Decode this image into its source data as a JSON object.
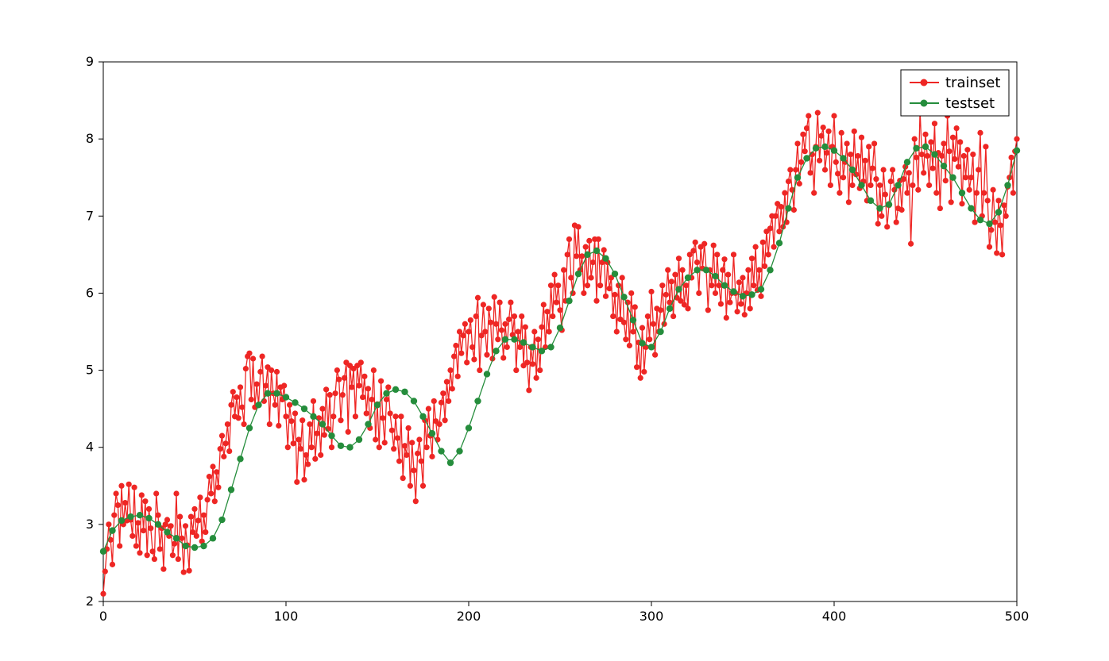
{
  "chart_data": {
    "type": "line",
    "title": "",
    "xlabel": "",
    "ylabel": "",
    "xlim": [
      0,
      500
    ],
    "ylim": [
      2,
      9
    ],
    "xticks": [
      0,
      100,
      200,
      300,
      400,
      500
    ],
    "yticks": [
      2,
      3,
      4,
      5,
      6,
      7,
      8,
      9
    ],
    "grid": false,
    "legend_position": "upper-right",
    "colors": {
      "trainset": "#ee2624",
      "testset": "#258d3c"
    },
    "series": [
      {
        "name": "trainset",
        "x_start": 0,
        "x_step": 1,
        "values": [
          2.1,
          2.39,
          2.68,
          3.0,
          2.8,
          2.48,
          3.12,
          3.4,
          3.25,
          2.72,
          3.5,
          3.0,
          3.28,
          3.05,
          3.52,
          3.06,
          2.85,
          3.48,
          2.72,
          3.02,
          2.63,
          3.38,
          2.92,
          3.3,
          2.6,
          3.2,
          2.95,
          2.65,
          2.55,
          3.4,
          3.12,
          2.68,
          2.95,
          2.42,
          3.0,
          3.06,
          2.85,
          2.98,
          2.6,
          2.75,
          3.4,
          2.55,
          3.1,
          2.82,
          2.38,
          2.98,
          2.73,
          2.4,
          3.1,
          2.9,
          3.2,
          2.85,
          3.05,
          3.35,
          2.78,
          3.12,
          2.9,
          3.32,
          3.62,
          3.4,
          3.75,
          3.3,
          3.68,
          3.48,
          3.98,
          4.15,
          3.88,
          4.05,
          4.3,
          3.95,
          4.55,
          4.72,
          4.4,
          4.65,
          4.38,
          4.78,
          4.52,
          4.3,
          5.02,
          5.18,
          5.22,
          4.62,
          5.15,
          4.52,
          4.82,
          4.55,
          4.98,
          5.18,
          4.6,
          4.8,
          5.04,
          4.3,
          5.0,
          4.7,
          4.55,
          4.98,
          4.28,
          4.78,
          4.62,
          4.8,
          4.4,
          4.0,
          4.55,
          4.34,
          4.05,
          4.44,
          3.55,
          4.1,
          3.98,
          4.35,
          3.58,
          3.9,
          3.78,
          4.3,
          4.0,
          4.6,
          3.85,
          4.18,
          4.38,
          3.9,
          4.5,
          4.16,
          4.75,
          4.24,
          4.68,
          4.0,
          4.4,
          4.7,
          5.0,
          4.88,
          4.35,
          4.68,
          4.9,
          5.1,
          4.2,
          5.06,
          4.78,
          5.02,
          4.4,
          5.06,
          4.8,
          5.1,
          4.65,
          4.92,
          4.44,
          4.76,
          4.25,
          4.62,
          5.0,
          4.1,
          4.56,
          4.0,
          4.86,
          4.38,
          4.06,
          4.62,
          4.78,
          4.44,
          4.22,
          3.98,
          4.4,
          4.12,
          3.82,
          4.4,
          3.6,
          4.02,
          3.9,
          4.25,
          3.5,
          4.06,
          3.7,
          3.3,
          3.92,
          4.1,
          3.82,
          3.5,
          4.35,
          4.0,
          4.5,
          4.15,
          3.88,
          4.6,
          4.34,
          4.1,
          4.3,
          4.58,
          4.7,
          4.35,
          4.85,
          4.6,
          5.0,
          4.76,
          5.18,
          5.32,
          4.92,
          5.5,
          5.22,
          5.45,
          5.6,
          5.1,
          5.5,
          5.65,
          5.3,
          5.14,
          5.7,
          5.94,
          5.0,
          5.45,
          5.85,
          5.5,
          5.2,
          5.8,
          5.62,
          5.15,
          5.95,
          5.6,
          5.4,
          5.88,
          5.52,
          5.16,
          5.6,
          5.3,
          5.66,
          5.88,
          5.46,
          5.7,
          5.0,
          5.5,
          5.3,
          5.7,
          5.06,
          5.56,
          5.1,
          4.74,
          5.3,
          5.08,
          5.5,
          4.9,
          5.4,
          5.0,
          5.56,
          5.85,
          5.3,
          5.76,
          5.5,
          6.1,
          5.7,
          6.24,
          5.88,
          6.1,
          5.78,
          5.52,
          6.3,
          5.9,
          6.5,
          6.7,
          6.2,
          6.0,
          6.88,
          6.48,
          6.86,
          6.3,
          6.48,
          6.0,
          6.6,
          6.1,
          6.68,
          6.2,
          6.4,
          6.7,
          5.9,
          6.7,
          6.1,
          6.4,
          6.56,
          5.96,
          6.4,
          6.06,
          6.2,
          5.7,
          5.98,
          5.5,
          6.1,
          5.66,
          6.2,
          5.62,
          5.4,
          5.88,
          5.32,
          6.0,
          5.5,
          5.82,
          5.04,
          5.36,
          4.9,
          5.55,
          4.98,
          5.3,
          5.7,
          5.4,
          6.02,
          5.6,
          5.2,
          5.8,
          5.5,
          5.78,
          6.1,
          5.6,
          5.98,
          6.3,
          5.88,
          6.15,
          5.7,
          6.24,
          5.94,
          6.45,
          5.9,
          6.3,
          5.85,
          6.1,
          5.8,
          6.5,
          6.2,
          6.55,
          6.66,
          6.4,
          6.0,
          6.6,
          6.32,
          6.64,
          6.3,
          5.78,
          6.3,
          6.1,
          6.62,
          6.0,
          6.5,
          6.1,
          5.86,
          6.3,
          6.44,
          5.68,
          6.24,
          5.88,
          6.0,
          6.5,
          6.0,
          5.76,
          6.14,
          5.86,
          6.2,
          5.72,
          6.0,
          6.3,
          5.8,
          6.45,
          6.1,
          6.6,
          6.04,
          6.3,
          5.96,
          6.66,
          6.35,
          6.8,
          6.5,
          6.84,
          7.0,
          6.6,
          7.0,
          7.16,
          6.8,
          7.12,
          6.86,
          7.3,
          6.92,
          7.45,
          7.6,
          7.34,
          7.08,
          7.6,
          7.94,
          7.42,
          7.7,
          8.06,
          7.84,
          8.14,
          8.3,
          7.56,
          7.8,
          7.3,
          7.9,
          8.34,
          7.72,
          8.04,
          8.15,
          7.6,
          7.82,
          8.1,
          7.4,
          7.9,
          8.3,
          7.7,
          7.55,
          7.3,
          8.08,
          7.5,
          7.7,
          7.94,
          7.18,
          7.8,
          7.4,
          8.1,
          7.54,
          7.78,
          7.36,
          8.02,
          7.45,
          7.72,
          7.2,
          7.9,
          7.4,
          7.62,
          7.94,
          7.48,
          6.9,
          7.4,
          7.0,
          7.6,
          7.28,
          6.86,
          7.14,
          7.45,
          7.6,
          7.34,
          6.92,
          7.1,
          7.46,
          7.08,
          7.48,
          7.64,
          7.3,
          7.56,
          6.64,
          7.4,
          8.0,
          7.76,
          7.34,
          8.38,
          7.8,
          7.56,
          8.06,
          7.78,
          7.4,
          7.96,
          7.62,
          8.2,
          7.3,
          7.82,
          7.1,
          7.78,
          7.94,
          7.46,
          8.3,
          7.84,
          7.18,
          8.02,
          7.74,
          8.14,
          7.64,
          7.96,
          7.16,
          7.78,
          7.5,
          7.86,
          7.34,
          7.5,
          7.8,
          6.92,
          7.3,
          7.6,
          8.08,
          7.0,
          7.3,
          7.9,
          7.2,
          6.6,
          6.82,
          7.34,
          6.92,
          6.52,
          7.2,
          6.88,
          6.5,
          7.14,
          7.0,
          7.38,
          7.5,
          7.76,
          7.3,
          7.84,
          8.0
        ]
      },
      {
        "name": "testset",
        "x_start": 0,
        "x_step": 5,
        "values": [
          2.65,
          2.92,
          3.05,
          3.1,
          3.12,
          3.08,
          3.0,
          2.9,
          2.82,
          2.72,
          2.7,
          2.72,
          2.82,
          3.06,
          3.45,
          3.85,
          4.25,
          4.55,
          4.7,
          4.7,
          4.65,
          4.58,
          4.5,
          4.4,
          4.3,
          4.15,
          4.02,
          4.0,
          4.1,
          4.3,
          4.55,
          4.7,
          4.75,
          4.72,
          4.6,
          4.4,
          4.18,
          3.95,
          3.8,
          3.95,
          4.25,
          4.6,
          4.95,
          5.25,
          5.4,
          5.4,
          5.36,
          5.3,
          5.25,
          5.3,
          5.55,
          5.9,
          6.25,
          6.5,
          6.55,
          6.45,
          6.25,
          5.95,
          5.65,
          5.35,
          5.3,
          5.5,
          5.8,
          6.05,
          6.2,
          6.3,
          6.3,
          6.22,
          6.1,
          6.02,
          5.96,
          5.98,
          6.05,
          6.3,
          6.65,
          7.1,
          7.5,
          7.75,
          7.88,
          7.9,
          7.85,
          7.75,
          7.6,
          7.4,
          7.2,
          7.1,
          7.15,
          7.4,
          7.7,
          7.88,
          7.9,
          7.8,
          7.65,
          7.5,
          7.3,
          7.1,
          6.95,
          6.9,
          7.05,
          7.4,
          7.85
        ]
      }
    ]
  },
  "legend": {
    "items": [
      {
        "label": "trainset",
        "color": "#ee2624"
      },
      {
        "label": "testset",
        "color": "#258d3c"
      }
    ]
  },
  "xtick_labels": [
    "0",
    "100",
    "200",
    "300",
    "400",
    "500"
  ],
  "ytick_labels": [
    "2",
    "3",
    "4",
    "5",
    "6",
    "7",
    "8",
    "9"
  ]
}
